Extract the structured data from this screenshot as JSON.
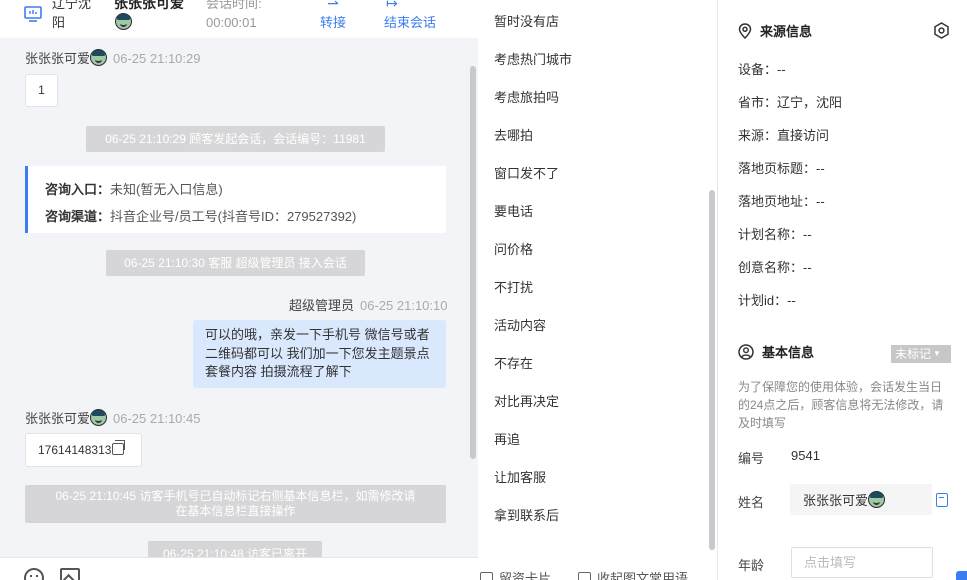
{
  "header": {
    "visitor_location": "辽宁沈阳",
    "visitor_nick": "张张张可爱",
    "session_time_label": "会话时间:",
    "session_time": "00:00:01",
    "transfer_label": "转接",
    "end_label": "结束会话"
  },
  "chat": {
    "msg1_sender": "张张张可爱",
    "msg1_time": "06-25 21:10:29",
    "msg1_text": "1",
    "sys1": "06-25 21:10:29 顾客发起会话，会话编号：11981",
    "card_entry_label": "咨询入口：",
    "card_entry_value": "未知(暂无入口信息)",
    "card_channel_label": "咨询渠道：",
    "card_channel_value": "抖音企业号/员工号(抖音号ID：279527392)",
    "sys2": "06-25 21:10:30 客服 超级管理员 接入会话",
    "agent_name": "超级管理员",
    "agent_time": "06-25 21:10:10",
    "agent_line1": "可以的哦，亲发一下手机号 微信号或者",
    "agent_line2": "二维码都可以 我们加一下您发主题景点",
    "agent_line3": "套餐内容 拍摄流程了解下",
    "msg2_sender": "张张张可爱",
    "msg2_time": "06-25 21:10:45",
    "msg2_text": "17614148313",
    "sys3_line1": "06-25 21:10:45 访客手机号已自动标记右侧基本信息栏，如需修改请",
    "sys3_line2": "在基本信息栏直接操作",
    "sys4": "06-25 21:10:48 访客已离开"
  },
  "quick_replies": [
    "暂时没有店",
    "考虑热门城市",
    "考虑旅拍吗",
    "去哪拍",
    "窗口发不了",
    "要电话",
    "问价格",
    "不打扰",
    "活动内容",
    "不存在",
    "对比再决定",
    "再追",
    "让加客服",
    "拿到联系后"
  ],
  "quick_footer": {
    "left_label": "留资卡片",
    "right_label": "收起图文常用语"
  },
  "source_info": {
    "title": "来源信息",
    "device": "设备：--",
    "province_city": "省市：辽宁，沈阳",
    "source": "来源：直接访问",
    "landing_title": "落地页标题：--",
    "landing_url": "落地页地址：--",
    "plan_name": "计划名称：--",
    "creative_name": "创意名称：--",
    "plan_id": "计划id：--"
  },
  "basic_info": {
    "title": "基本信息",
    "tag": "未标记",
    "note": "为了保障您的使用体验，会话发生当日的24点之后，顾客信息将无法修改，请及时填写",
    "code_label": "编号",
    "code_value": "9541",
    "name_label": "姓名",
    "name_value": "张张张可爱",
    "age_label": "年龄",
    "age_placeholder": "点击填写"
  },
  "colors": {
    "accent": "#3a7df0",
    "agent_bubble": "#d9e8fd",
    "system_notice": "#d6d6d8",
    "chat_bg": "#f3f4f7"
  }
}
